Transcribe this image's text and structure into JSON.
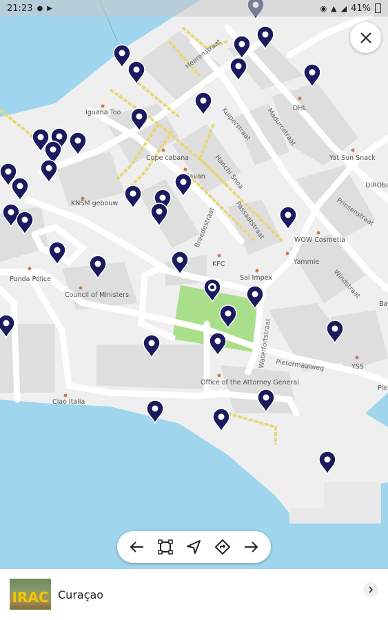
{
  "status_bar": {
    "time": "21:23",
    "battery": "41%"
  },
  "map": {
    "street_labels": [
      "Heerenstraat",
      "Madurostraat",
      "Kuiperstraat",
      "Hanchi Snoa",
      "Passaatstraat",
      "Prinsenstraat",
      "Windstraat",
      "Breedestraat",
      "Pietermaaiweg",
      "Waterfortstraat",
      "Pie"
    ],
    "place_labels": [
      "DHL",
      "Iguana Too",
      "Cope cabana",
      "Zavan",
      "KNSM gebouw",
      "Yat Sun Snack",
      "DiRObar",
      "WOW Cosmetia",
      "Yammie",
      "KFC",
      "Sai Impex",
      "Punda Police",
      "Council of Ministers",
      "Ba",
      "YSS",
      "Office of the Attorney General",
      "Ciao Italia"
    ]
  },
  "toolbar": {
    "buttons": [
      "back-arrow-icon",
      "bounding-box-icon",
      "navigate-icon",
      "directions-icon",
      "forward-arrow-icon"
    ]
  },
  "bottom": {
    "thumbnail_text": "IRAC",
    "place_name": "Curaçao"
  },
  "colors": {
    "water": "#9fd6ee",
    "land": "#efefef",
    "block": "#dedede",
    "park": "#a9df8a",
    "pin": "#1a1a5e",
    "road_yellow": "#e8d77a"
  }
}
